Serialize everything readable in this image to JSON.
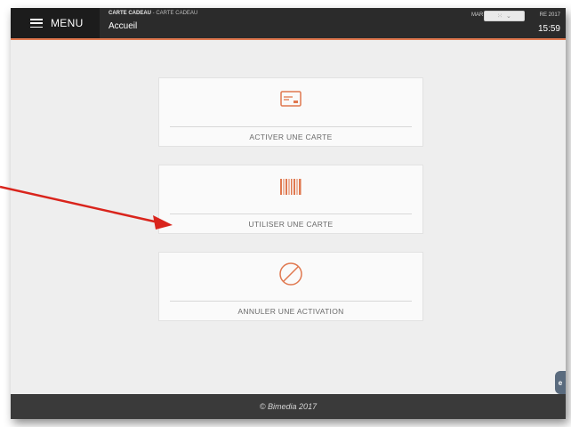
{
  "header": {
    "menu_label": "MENU",
    "breadcrumb_primary": "CARTE CADEAU",
    "breadcrumb_secondary": "- CARTE CADEAU",
    "page_title": "Accueil",
    "date_text": "MAR",
    "date_text_end": "RE 2017",
    "clock": "15:59"
  },
  "cards": [
    {
      "label": "ACTIVER UNE CARTE",
      "icon": "credit-card-icon"
    },
    {
      "label": "UTILISER UNE CARTE",
      "icon": "barcode-icon"
    },
    {
      "label": "ANNULER UNE ACTIVATION",
      "icon": "cancel-circle-icon"
    }
  ],
  "footer": {
    "copyright": "© Bimedia 2017"
  },
  "colors": {
    "accent": "#e0784f",
    "topbar": "#2b2b2b",
    "background": "#eeeeee",
    "annotation_arrow": "#d9241c"
  }
}
